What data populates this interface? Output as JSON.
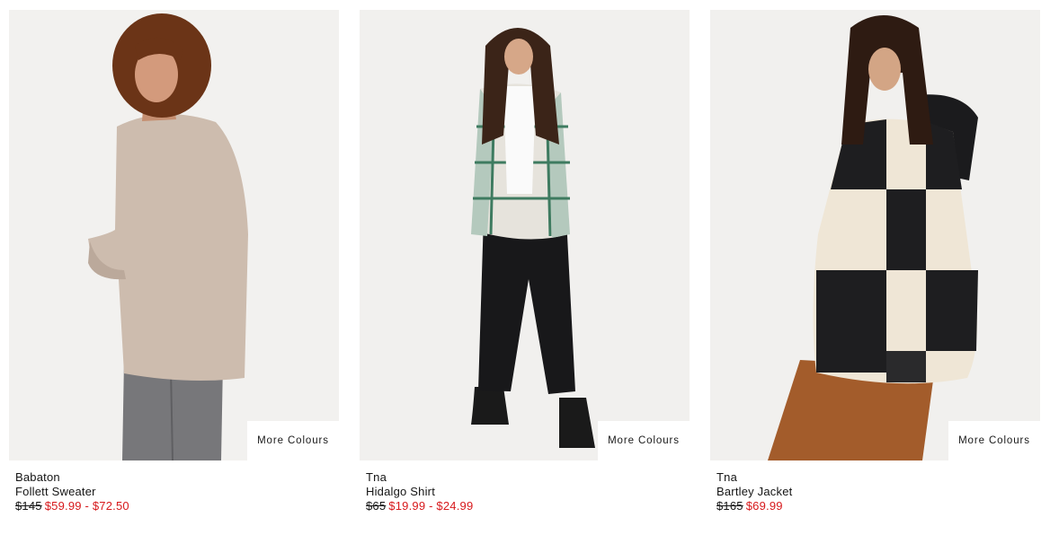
{
  "products": [
    {
      "brand": "Babaton",
      "name": "Follett Sweater",
      "original_price": "$145",
      "sale_price": "$59.99 - $72.50",
      "more_colours": "More Colours"
    },
    {
      "brand": "Tna",
      "name": "Hidalgo Shirt",
      "original_price": "$65",
      "sale_price": "$19.99 - $24.99",
      "more_colours": "More Colours"
    },
    {
      "brand": "Tna",
      "name": "Bartley Jacket",
      "original_price": "$165",
      "sale_price": "$69.99",
      "more_colours": "More Colours"
    }
  ],
  "colors": {
    "sale": "#d7191c",
    "text": "#151515",
    "image_background": "#f1f0ee"
  }
}
